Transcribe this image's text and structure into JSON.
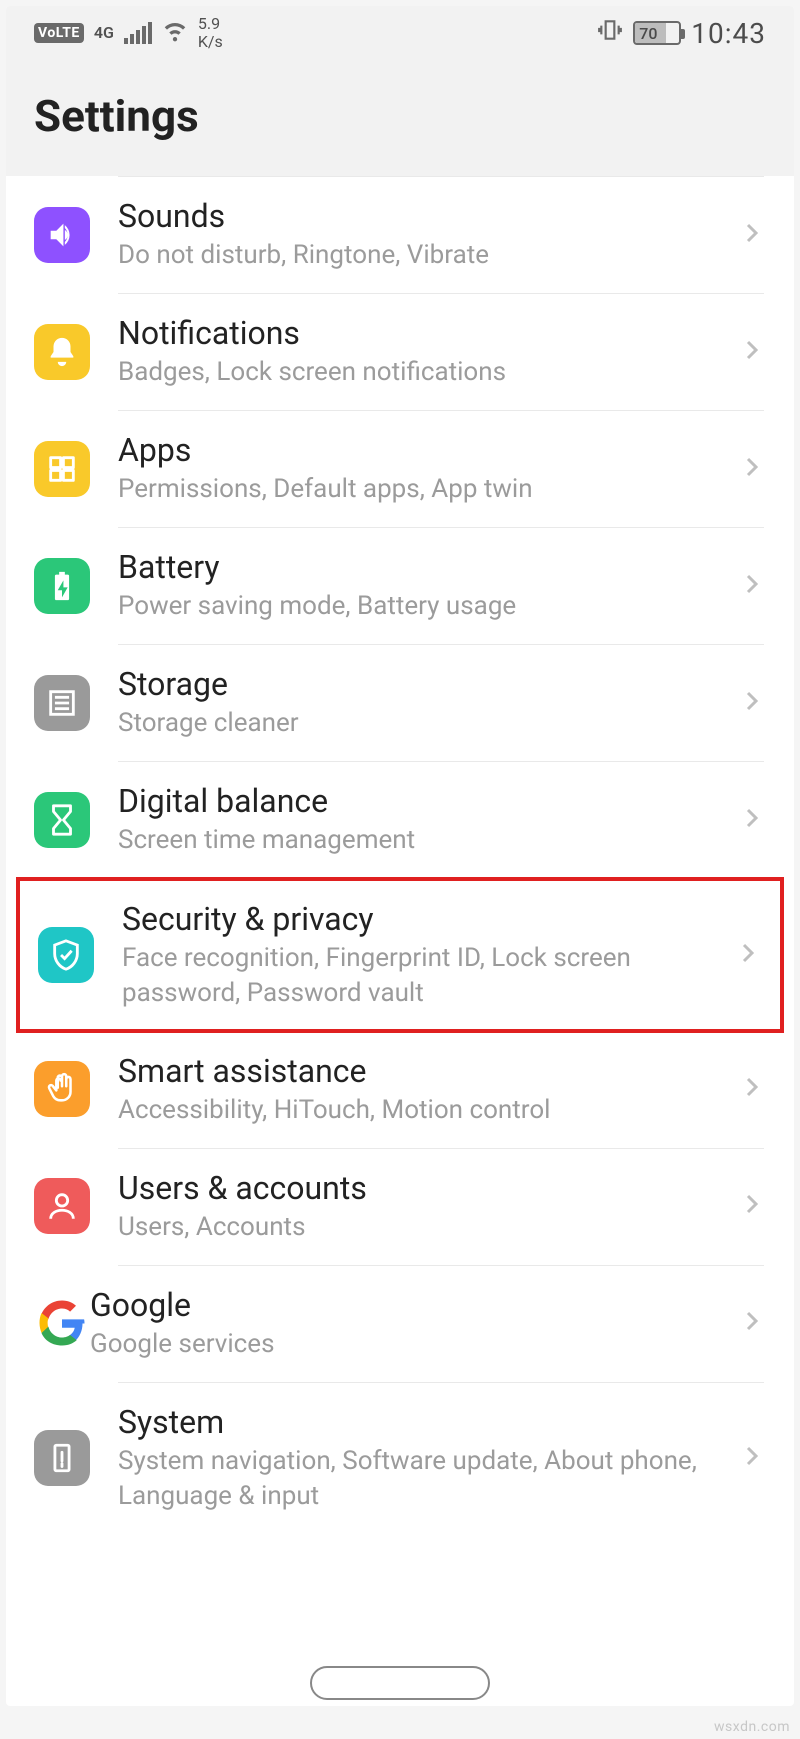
{
  "status": {
    "volte": "VoLTE",
    "net_label": "4G",
    "speed_top": "5.9",
    "speed_bottom": "K/s",
    "battery_pct": "70",
    "time": "10:43"
  },
  "header": {
    "title": "Settings"
  },
  "items": [
    {
      "id": "sounds",
      "label": "Sounds",
      "sub": "Do not disturb, Ringtone, Vibrate"
    },
    {
      "id": "notif",
      "label": "Notifications",
      "sub": "Badges, Lock screen notifications"
    },
    {
      "id": "apps",
      "label": "Apps",
      "sub": "Permissions, Default apps, App twin"
    },
    {
      "id": "battery",
      "label": "Battery",
      "sub": "Power saving mode, Battery usage"
    },
    {
      "id": "storage",
      "label": "Storage",
      "sub": "Storage cleaner"
    },
    {
      "id": "digital",
      "label": "Digital balance",
      "sub": "Screen time management"
    },
    {
      "id": "security",
      "label": "Security & privacy",
      "sub": "Face recognition, Fingerprint ID, Lock screen password, Password vault"
    },
    {
      "id": "smart",
      "label": "Smart assistance",
      "sub": "Accessibility, HiTouch, Motion control"
    },
    {
      "id": "users",
      "label": "Users & accounts",
      "sub": "Users, Accounts"
    },
    {
      "id": "google",
      "label": "Google",
      "sub": "Google services"
    },
    {
      "id": "system",
      "label": "System",
      "sub": "System navigation, Software update, About phone, Language & input"
    }
  ],
  "watermark": "wsxdn.com"
}
